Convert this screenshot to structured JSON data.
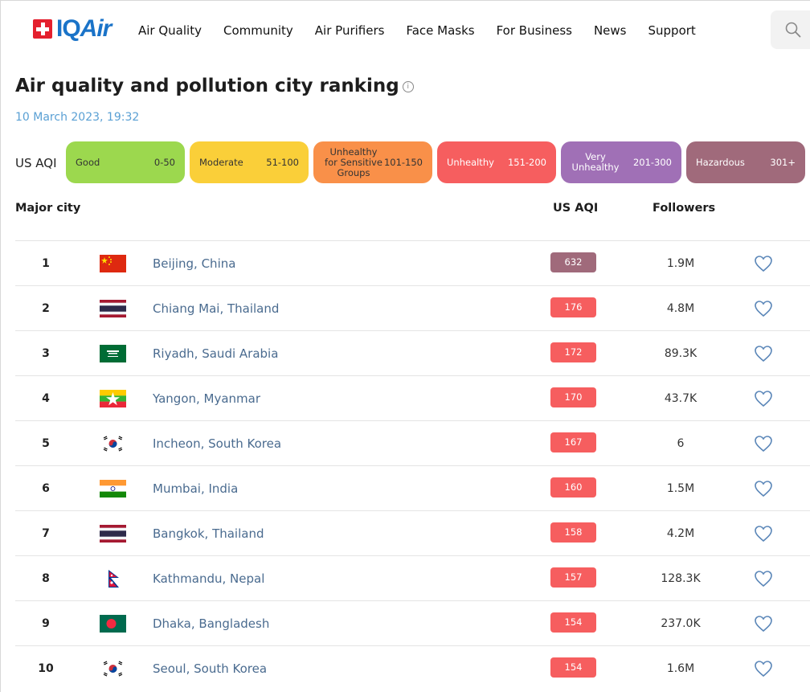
{
  "header": {
    "logo": "IQAir",
    "nav": [
      "Air Quality",
      "Community",
      "Air Purifiers",
      "Face Masks",
      "For Business",
      "News",
      "Support"
    ]
  },
  "page": {
    "title": "Air quality and pollution city ranking",
    "date": "10 March 2023, 19:32"
  },
  "legend": {
    "label": "US AQI",
    "items": [
      {
        "name": "Good",
        "range": "0-50",
        "color": "#9cd84e",
        "text": "#333333"
      },
      {
        "name": "Moderate",
        "range": "51-100",
        "color": "#facf39",
        "text": "#333333"
      },
      {
        "name": "Unhealthy for Sensitive Groups",
        "range": "101-150",
        "color": "#f99049",
        "text": "#333333"
      },
      {
        "name": "Unhealthy",
        "range": "151-200",
        "color": "#f65e5f",
        "text": "#ffffff"
      },
      {
        "name": "Very Unhealthy",
        "range": "201-300",
        "color": "#a070b6",
        "text": "#ffffff"
      },
      {
        "name": "Hazardous",
        "range": "301+",
        "color": "#a06a7b",
        "text": "#ffffff"
      }
    ]
  },
  "table": {
    "headers": {
      "city": "Major city",
      "aqi": "US AQI",
      "followers": "Followers"
    },
    "rows": [
      {
        "rank": "1",
        "flag": "china-flag",
        "city": "Beijing, China",
        "aqi": "632",
        "aqi_color": "#a06a7b",
        "followers": "1.9M"
      },
      {
        "rank": "2",
        "flag": "thailand-flag",
        "city": "Chiang Mai, Thailand",
        "aqi": "176",
        "aqi_color": "#f65e5f",
        "followers": "4.8M"
      },
      {
        "rank": "3",
        "flag": "saudi-arabia-flag",
        "city": "Riyadh, Saudi Arabia",
        "aqi": "172",
        "aqi_color": "#f65e5f",
        "followers": "89.3K"
      },
      {
        "rank": "4",
        "flag": "myanmar-flag",
        "city": "Yangon, Myanmar",
        "aqi": "170",
        "aqi_color": "#f65e5f",
        "followers": "43.7K"
      },
      {
        "rank": "5",
        "flag": "south-korea-flag",
        "city": "Incheon, South Korea",
        "aqi": "167",
        "aqi_color": "#f65e5f",
        "followers": "6"
      },
      {
        "rank": "6",
        "flag": "india-flag",
        "city": "Mumbai, India",
        "aqi": "160",
        "aqi_color": "#f65e5f",
        "followers": "1.5M"
      },
      {
        "rank": "7",
        "flag": "thailand-flag",
        "city": "Bangkok, Thailand",
        "aqi": "158",
        "aqi_color": "#f65e5f",
        "followers": "4.2M"
      },
      {
        "rank": "8",
        "flag": "nepal-flag",
        "city": "Kathmandu, Nepal",
        "aqi": "157",
        "aqi_color": "#f65e5f",
        "followers": "128.3K"
      },
      {
        "rank": "9",
        "flag": "bangladesh-flag",
        "city": "Dhaka, Bangladesh",
        "aqi": "154",
        "aqi_color": "#f65e5f",
        "followers": "237.0K"
      },
      {
        "rank": "10",
        "flag": "south-korea-flag",
        "city": "Seoul, South Korea",
        "aqi": "154",
        "aqi_color": "#f65e5f",
        "followers": "1.6M"
      }
    ]
  }
}
